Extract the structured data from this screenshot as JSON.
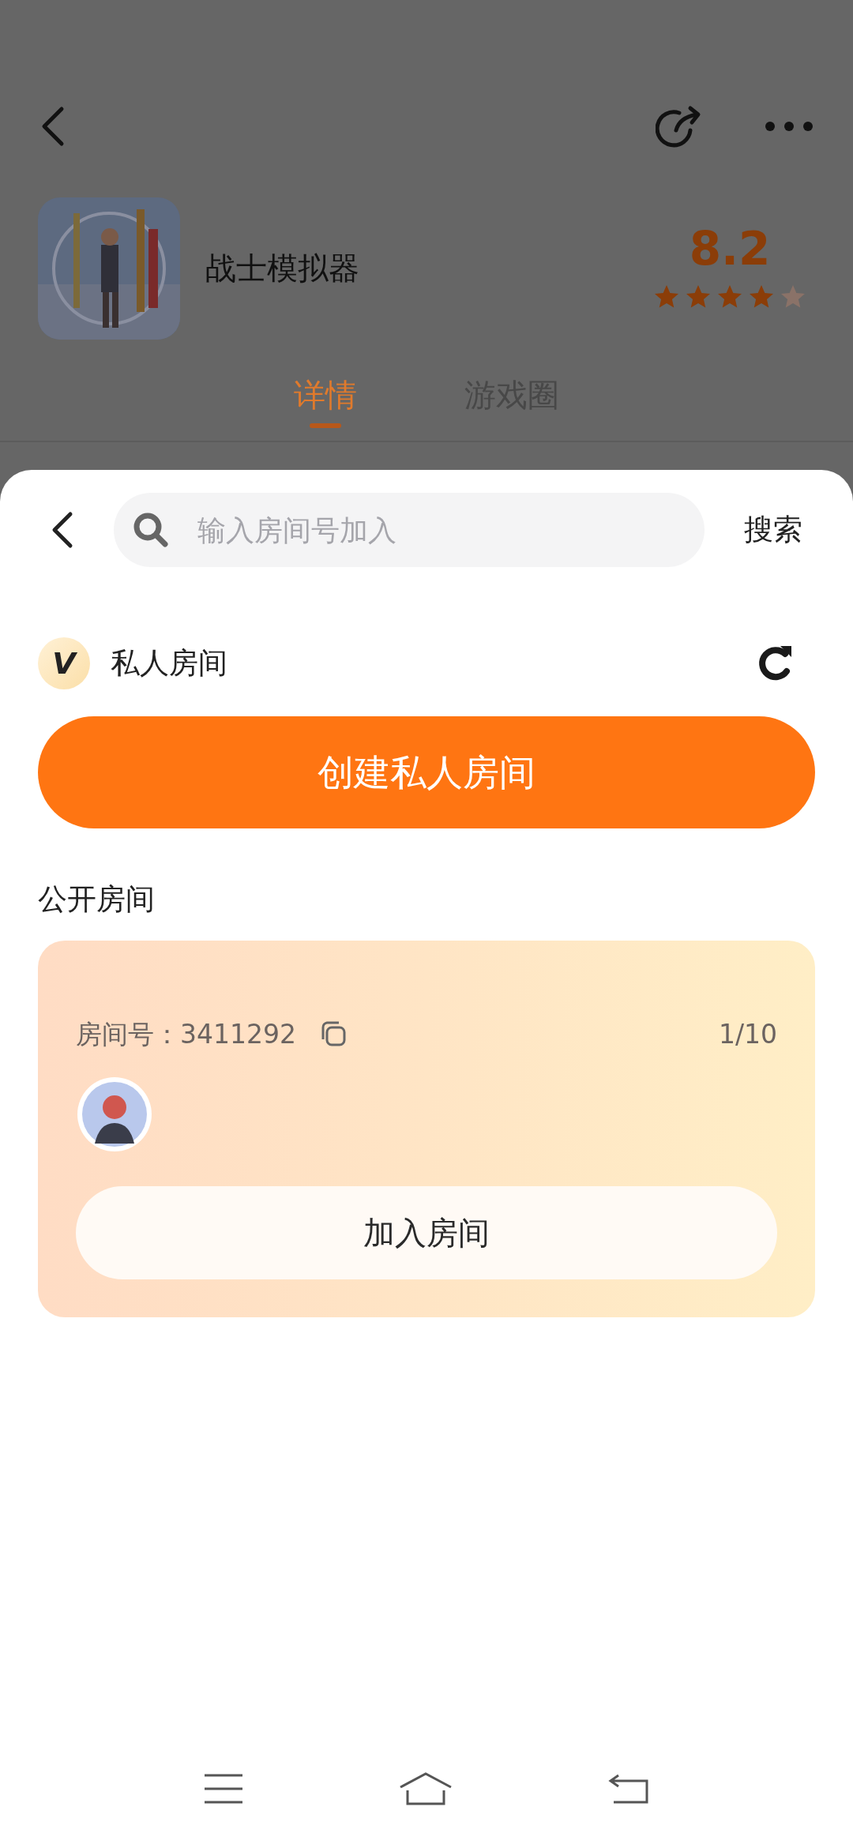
{
  "app": {
    "name": "战士模拟器",
    "score": "8.2",
    "stars": 4
  },
  "tabs": [
    {
      "label": "详情",
      "selected": true
    },
    {
      "label": "游戏圈",
      "selected": false
    }
  ],
  "sheet": {
    "search": {
      "placeholder": "输入房间号加入",
      "button": "搜索"
    },
    "private_rooms": {
      "title": "私人房间",
      "badge": "V",
      "create_button": "创建私人房间"
    },
    "public_rooms": {
      "title": "公开房间",
      "rooms": [
        {
          "label": "房间号：",
          "number": "3411292",
          "occupancy": "1/10",
          "join_button": "加入房间"
        }
      ]
    }
  }
}
